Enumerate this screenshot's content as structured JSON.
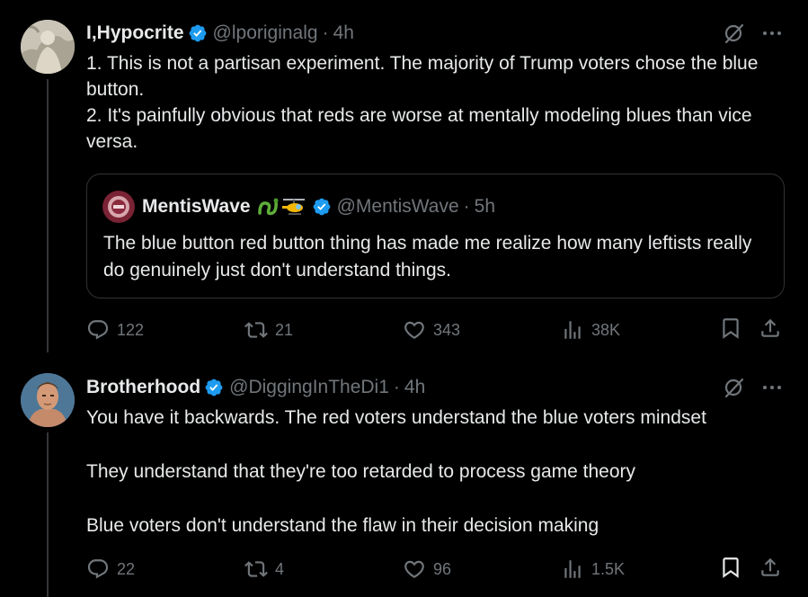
{
  "tweets": [
    {
      "name": "I,Hypocrite",
      "handle": "@lporiginalg",
      "dot": "·",
      "time": "4h",
      "text": "1. This is not a partisan experiment. The majority of Trump voters chose the blue button.\n2. It's painfully obvious that reds are worse at mentally modeling blues than vice versa.",
      "quote": {
        "name": "MentisWave",
        "handle": "@MentisWave",
        "dot": "·",
        "time": "5h",
        "text": "The blue button red button thing has made me realize how many leftists really do genuinely just don't understand things."
      },
      "stats": {
        "replies": "122",
        "reposts": "21",
        "likes": "343",
        "views": "38K"
      }
    },
    {
      "name": "Brotherhood",
      "handle": "@DiggingInTheDi1",
      "dot": "·",
      "time": "4h",
      "text": "You have it backwards. The red voters understand the blue voters mindset\n\nThey understand that they're too retarded to process game theory\n\nBlue voters don't understand the flaw in their decision making",
      "stats": {
        "replies": "22",
        "reposts": "4",
        "likes": "96",
        "views": "1.5K"
      }
    }
  ],
  "colors": {
    "background": "#000000",
    "text": "#e7e9ea",
    "muted": "#71767b",
    "verified": "#1d9bf0",
    "border": "#2f3336"
  },
  "icons": [
    "verified-icon",
    "grok-icon",
    "more-icon",
    "reply-icon",
    "repost-icon",
    "like-icon",
    "views-icon",
    "bookmark-icon",
    "share-icon"
  ]
}
